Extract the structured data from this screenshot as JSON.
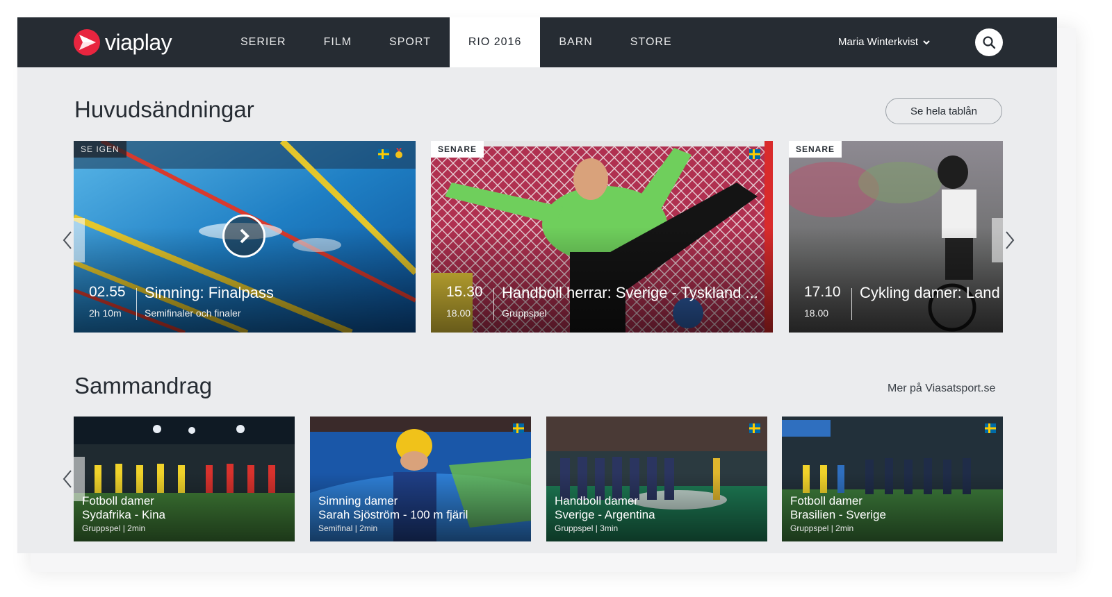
{
  "header": {
    "logo_text": "viaplay",
    "nav": [
      {
        "label": "SERIER"
      },
      {
        "label": "FILM"
      },
      {
        "label": "SPORT"
      },
      {
        "label": "RIO 2016",
        "active": true
      },
      {
        "label": "BARN"
      },
      {
        "label": "STORE"
      }
    ],
    "user_name": "Maria Winterkvist",
    "icons": {
      "user_menu": "chevron-down-icon",
      "search": "search-icon",
      "logo": "viaplay-logo-icon"
    }
  },
  "main_broadcasts": {
    "title": "Huvudsändningar",
    "schedule_button": "Se hela tablån",
    "cards": [
      {
        "badge": "SE IGEN",
        "time": "02.55",
        "duration": "2h 10m",
        "title": "Simning: Finalpass",
        "subtitle": "Semifinaler och finaler",
        "play_icon": "chevron-right-icon"
      },
      {
        "badge": "SENARE",
        "time": "15.30",
        "duration": "18.00",
        "title": "Handboll herrar: Sverige - Tyskland ...",
        "subtitle": "Gruppspel"
      },
      {
        "badge": "SENARE",
        "time": "17.10",
        "duration": "18.00",
        "title": "Cykling damer: Land",
        "subtitle": ""
      }
    ]
  },
  "summaries": {
    "title": "Sammandrag",
    "more_link": "Mer på Viasatsport.se",
    "cards": [
      {
        "line1": "Fotboll damer",
        "line2": "Sydafrika - Kina",
        "line3": "Gruppspel | 2min"
      },
      {
        "line1": "Simning damer",
        "line2": "Sarah Sjöström - 100 m fjäril",
        "line3": "Semifinal | 2min"
      },
      {
        "line1": "Handboll damer",
        "line2": "Sverige - Argentina",
        "line3": "Gruppspel | 3min"
      },
      {
        "line1": "Fotboll damer",
        "line2": "Brasilien - Sverige",
        "line3": "Gruppspel | 2min"
      }
    ]
  },
  "colors": {
    "header_bg": "#262c33",
    "page_bg": "#ebecee",
    "logo_red": "#e8253f",
    "flag_blue": "#006aa7",
    "flag_yellow": "#fecc00"
  }
}
